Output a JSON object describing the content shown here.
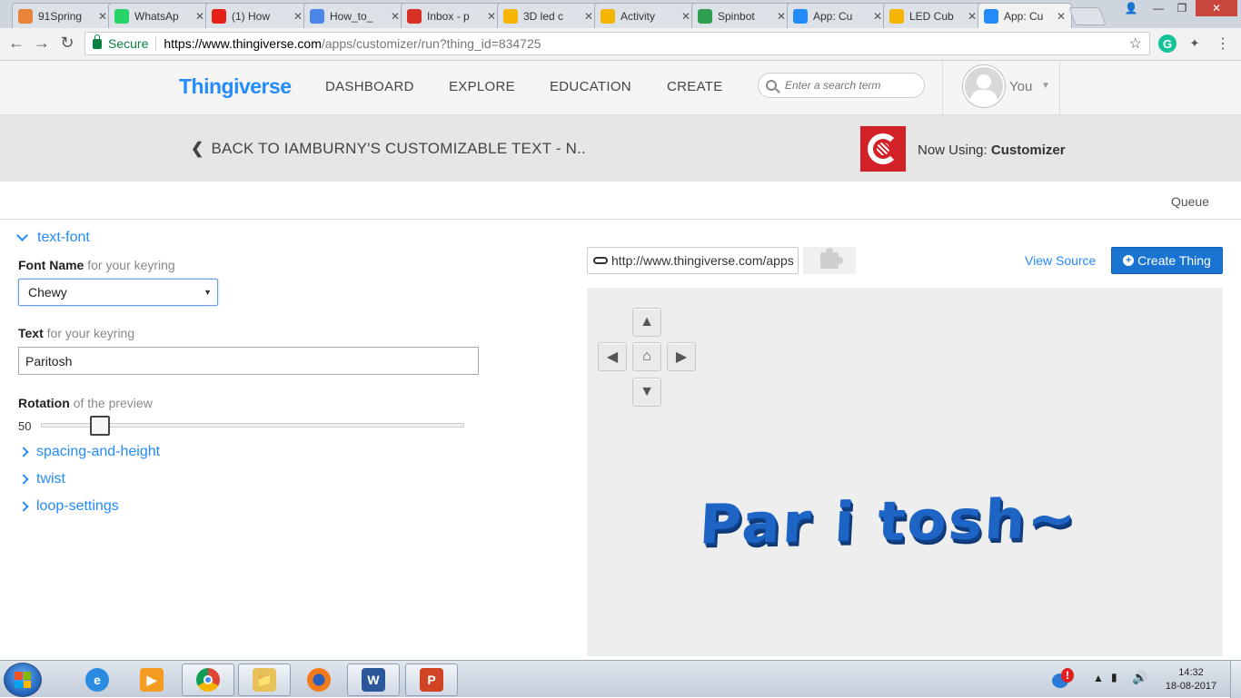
{
  "browser": {
    "tabs": [
      {
        "title": "91Spring",
        "icon": "spring-icon",
        "color": "#e8833a"
      },
      {
        "title": "WhatsAp",
        "icon": "whatsapp-icon",
        "color": "#25d366"
      },
      {
        "title": "(1) How",
        "icon": "youtube-icon",
        "color": "#e62117"
      },
      {
        "title": "How_to_",
        "icon": "document-icon",
        "color": "#4a86e8"
      },
      {
        "title": "Inbox - p",
        "icon": "gmail-icon",
        "color": "#d93025"
      },
      {
        "title": "3D led c",
        "icon": "instructables-icon",
        "color": "#f5b400"
      },
      {
        "title": "Activity",
        "icon": "instructables-icon",
        "color": "#f5b400"
      },
      {
        "title": "Spinbot",
        "icon": "spinbot-icon",
        "color": "#2e9e4f"
      },
      {
        "title": "App: Cu",
        "icon": "thingiverse-icon",
        "color": "#248bfb"
      },
      {
        "title": "LED Cub",
        "icon": "instructables-icon",
        "color": "#f5b400"
      },
      {
        "title": "App: Cu",
        "icon": "thingiverse-icon",
        "color": "#248bfb"
      }
    ],
    "secure_label": "Secure",
    "url_host": "https://www.thingiverse.com",
    "url_path": "/apps/customizer/run?thing_id=834725"
  },
  "header": {
    "logo": "Thingiverse",
    "nav": [
      "DASHBOARD",
      "EXPLORE",
      "EDUCATION",
      "CREATE"
    ],
    "search_placeholder": "Enter a search term",
    "user_label": "You"
  },
  "backbar": {
    "back_label": "BACK TO IAMBURNY'S CUSTOMIZABLE TEXT - N..",
    "now_using_prefix": "Now Using:",
    "now_using_app": "Customizer"
  },
  "queue_label": "Queue",
  "params": {
    "section_open": "text-font",
    "font_name_label": "Font Name",
    "font_name_hint": "for your keyring",
    "font_name_value": "Chewy",
    "text_label": "Text",
    "text_hint": "for your keyring",
    "text_value": "Paritosh",
    "rotation_label": "Rotation",
    "rotation_hint": "of the preview",
    "rotation_value": "50",
    "rotation_fraction": 0.14,
    "collapsed_sections": [
      "spacing-and-height",
      "twist",
      "loop-settings"
    ]
  },
  "toolbar": {
    "share_url": "http://www.thingiverse.com/apps",
    "view_source": "View Source",
    "create_thing": "Create Thing"
  },
  "preview": {
    "model_text": "Par i tosh~",
    "model_color": "#1e64c4"
  },
  "taskbar": {
    "apps": [
      "internet-explorer-icon",
      "media-player-icon",
      "chrome-icon",
      "file-explorer-icon",
      "firefox-icon",
      "word-icon",
      "powerpoint-icon"
    ],
    "time": "14:32",
    "date": "18-08-2017"
  }
}
